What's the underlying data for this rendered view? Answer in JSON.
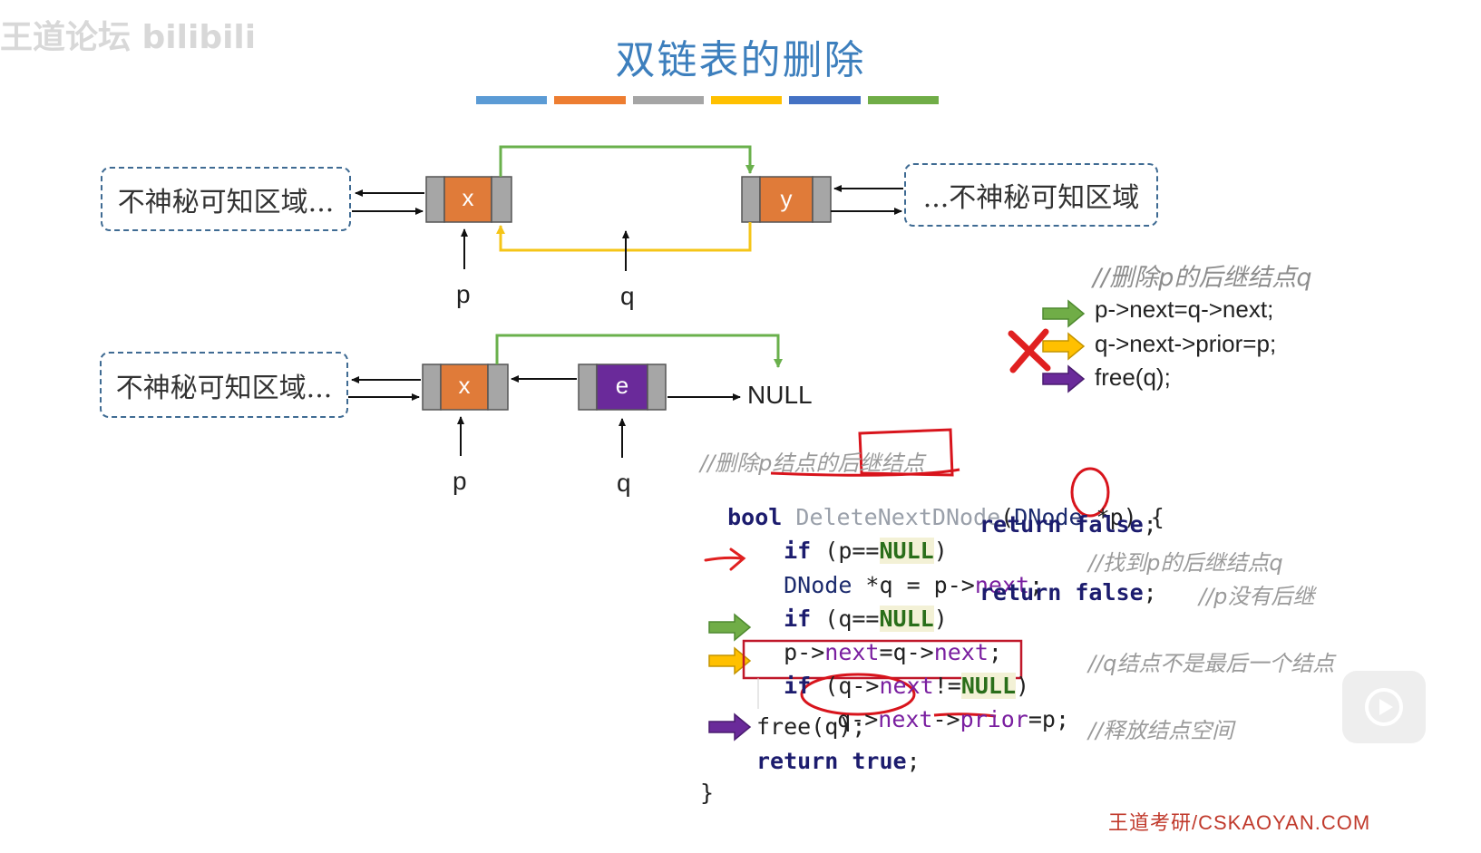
{
  "watermark": "王道论坛 bilibili",
  "title": "双链表的删除",
  "color_bar": [
    "#5b9bd5",
    "#ed7d31",
    "#a5a5a5",
    "#ffc000",
    "#4472c4",
    "#70ad47"
  ],
  "diagram_top": {
    "left_region": "不神秘可知区域...",
    "right_region": "...不神秘可知区域",
    "node_x": "x",
    "node_y": "y",
    "pointer_p": "p",
    "pointer_q": "q"
  },
  "diagram_bottom": {
    "left_region": "不神秘可知区域...",
    "node_x": "x",
    "node_e": "e",
    "null_label": "NULL",
    "pointer_p": "p",
    "pointer_q": "q"
  },
  "steps": {
    "comment": "//删除p的后继结点q",
    "step1": "p->next=q->next;",
    "step2": "q->next->prior=p;",
    "step3": "free(q);"
  },
  "code": {
    "comment": "//删除p结点的后继结点",
    "line1_kw": "bool",
    "line1_fn": "DeleteNextDNode",
    "line1_type": "DNode",
    "line1_param": "*p",
    "line2_if": "if",
    "line2_cond_a": "(p==",
    "line2_null": "NULL",
    "line2_cond_b": ")",
    "line2_ret": "return false",
    "line3_type": "DNode",
    "line3_rest_a": " *q = p->",
    "line3_next": "next",
    "line3_rest_b": ";",
    "line3_cmt": "//找到p的后继结点q",
    "line4_if": "if",
    "line4_cond_a": "(q==",
    "line4_null": "NULL",
    "line4_cond_b": ")",
    "line4_ret": "return false",
    "line4_cmt": "//p没有后继",
    "line5_a": "p->",
    "line5_next": "next",
    "line5_b": "=q->",
    "line5_next2": "next",
    "line5_c": ";",
    "line6_if": "if",
    "line6_a": "(q->",
    "line6_next": "next",
    "line6_b": "!=",
    "line6_null": "NULL",
    "line6_c": ")",
    "line6_cmt": "//q结点不是最后一个结点",
    "line7_a": "q->",
    "line7_next": "next",
    "line7_b": "->",
    "line7_prior": "prior",
    "line7_c": "=p;",
    "line8": "free(q);",
    "line8_cmt": "//释放结点空间",
    "line9_ret": "return true",
    "line9_semi": ";",
    "closing_brace": "}"
  },
  "site": "王道考研/CSKAOYAN.COM"
}
